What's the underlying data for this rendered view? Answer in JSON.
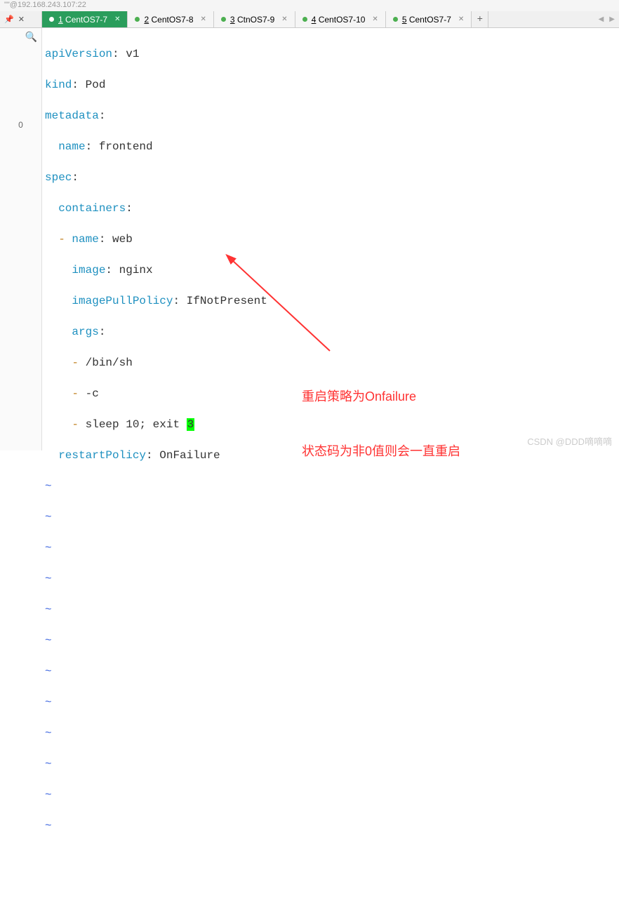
{
  "titlebar": {
    "text": "\"\"@192.168.243.107:22"
  },
  "tabs": {
    "items": [
      {
        "num": "1",
        "label": "CentOS7-7",
        "active": true
      },
      {
        "num": "2",
        "label": "CentOS7-8",
        "active": false
      },
      {
        "num": "3",
        "label": "CtnOS7-9",
        "active": false
      },
      {
        "num": "4",
        "label": "CentOS7-10",
        "active": false
      },
      {
        "num": "5",
        "label": "CentOS7-7",
        "active": false
      }
    ]
  },
  "gutter": {
    "line_marker": "0"
  },
  "code": {
    "l1": {
      "k": "apiVersion",
      "v": "v1"
    },
    "l2": {
      "k": "kind",
      "v": "Pod"
    },
    "l3": {
      "k": "metadata"
    },
    "l4": {
      "k": "name",
      "v": "frontend"
    },
    "l5": {
      "k": "spec"
    },
    "l6": {
      "k": "containers"
    },
    "l7": {
      "k": "name",
      "v": "web"
    },
    "l8": {
      "k": "image",
      "v": "nginx"
    },
    "l9": {
      "k": "imagePullPolicy",
      "v": "IfNotPresent"
    },
    "l10": {
      "k": "args"
    },
    "l11": {
      "v": "/bin/sh"
    },
    "l12": {
      "v": "-c"
    },
    "l13": {
      "v1": "sleep 10; exit ",
      "v2": "3"
    },
    "l14": {
      "k": "restartPolicy",
      "v": "OnFailure"
    }
  },
  "annotation": {
    "line1": "重启策略为Onfailure",
    "line2": "状态码为非0值则会一直重启"
  },
  "watermark": "CSDN @DDD嘀嘀嘀"
}
